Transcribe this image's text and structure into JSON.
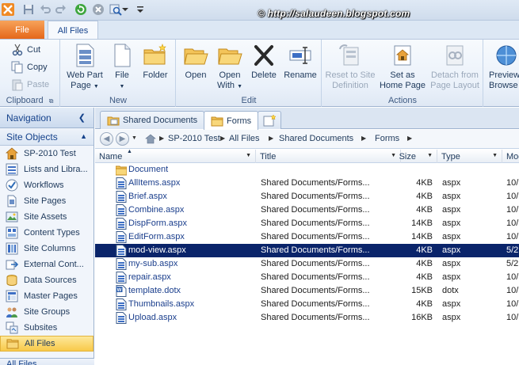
{
  "watermark": "© http://salaudeen.blogspot.com",
  "quick_access": {
    "icons": [
      "sharepoint-designer-logo-icon",
      "save-icon",
      "undo-icon",
      "redo-icon",
      "refresh-icon",
      "stop-icon",
      "preview-icon",
      "customize-toolbar-icon"
    ]
  },
  "tabs": {
    "file": "File",
    "all_files": "All Files"
  },
  "ribbon": {
    "clipboard": {
      "label": "Clipboard",
      "cut": "Cut",
      "copy": "Copy",
      "paste": "Paste"
    },
    "new": {
      "label": "New",
      "web_part_page_l1": "Web Part",
      "web_part_page_l2": "Page",
      "file_l1": "File",
      "folder": "Folder"
    },
    "edit": {
      "label": "Edit",
      "open": "Open",
      "open_with_l1": "Open",
      "open_with_l2": "With",
      "delete": "Delete",
      "rename": "Rename"
    },
    "actions": {
      "label": "Actions",
      "reset_l1": "Reset to Site",
      "reset_l2": "Definition",
      "set_home_l1": "Set as",
      "set_home_l2": "Home Page",
      "detach_l1": "Detach from",
      "detach_l2": "Page Layout"
    },
    "preview": {
      "l1": "Preview",
      "l2": "Browse"
    }
  },
  "navigation": {
    "title": "Navigation",
    "section": "Site Objects",
    "items": [
      {
        "label": "SP-2010 Test",
        "icon": "site-home-icon"
      },
      {
        "label": "Lists and Libra...",
        "icon": "lists-icon"
      },
      {
        "label": "Workflows",
        "icon": "workflow-icon"
      },
      {
        "label": "Site Pages",
        "icon": "site-pages-icon"
      },
      {
        "label": "Site Assets",
        "icon": "site-assets-icon"
      },
      {
        "label": "Content Types",
        "icon": "content-types-icon"
      },
      {
        "label": "Site Columns",
        "icon": "site-columns-icon"
      },
      {
        "label": "External Cont...",
        "icon": "external-content-icon"
      },
      {
        "label": "Data Sources",
        "icon": "data-sources-icon"
      },
      {
        "label": "Master Pages",
        "icon": "master-pages-icon"
      },
      {
        "label": "Site Groups",
        "icon": "site-groups-icon"
      },
      {
        "label": "Subsites",
        "icon": "subsites-icon"
      },
      {
        "label": "All Files",
        "icon": "all-files-icon"
      }
    ],
    "bottom_section": "All Files"
  },
  "doc_tabs": [
    {
      "label": "Shared Documents"
    },
    {
      "label": "Forms"
    }
  ],
  "breadcrumb": [
    "SP-2010 Test",
    "All Files",
    "Shared Documents",
    "Forms"
  ],
  "columns": {
    "name": "Name",
    "title": "Title",
    "size": "Size",
    "type": "Type",
    "modified": "Mod"
  },
  "files": [
    {
      "name": "Document",
      "title": "",
      "size": "",
      "type": "",
      "mod": "",
      "kind": "folder"
    },
    {
      "name": "AllItems.aspx",
      "title": "Shared Documents/Forms...",
      "size": "4KB",
      "type": "aspx",
      "mod": "10/",
      "kind": "page"
    },
    {
      "name": "Brief.aspx",
      "title": "Shared Documents/Forms...",
      "size": "4KB",
      "type": "aspx",
      "mod": "10/",
      "kind": "page"
    },
    {
      "name": "Combine.aspx",
      "title": "Shared Documents/Forms...",
      "size": "4KB",
      "type": "aspx",
      "mod": "10/",
      "kind": "page"
    },
    {
      "name": "DispForm.aspx",
      "title": "Shared Documents/Forms...",
      "size": "14KB",
      "type": "aspx",
      "mod": "10/",
      "kind": "page"
    },
    {
      "name": "EditForm.aspx",
      "title": "Shared Documents/Forms...",
      "size": "14KB",
      "type": "aspx",
      "mod": "10/",
      "kind": "page"
    },
    {
      "name": "mod-view.aspx",
      "title": "Shared Documents/Forms...",
      "size": "4KB",
      "type": "aspx",
      "mod": "5/2",
      "kind": "page",
      "selected": true
    },
    {
      "name": "my-sub.aspx",
      "title": "Shared Documents/Forms...",
      "size": "4KB",
      "type": "aspx",
      "mod": "5/2",
      "kind": "page"
    },
    {
      "name": "repair.aspx",
      "title": "Shared Documents/Forms...",
      "size": "4KB",
      "type": "aspx",
      "mod": "10/",
      "kind": "page"
    },
    {
      "name": "template.dotx",
      "title": "Shared Documents/Forms...",
      "size": "15KB",
      "type": "dotx",
      "mod": "10/",
      "kind": "word"
    },
    {
      "name": "Thumbnails.aspx",
      "title": "Shared Documents/Forms...",
      "size": "4KB",
      "type": "aspx",
      "mod": "10/",
      "kind": "page"
    },
    {
      "name": "Upload.aspx",
      "title": "Shared Documents/Forms...",
      "size": "16KB",
      "type": "aspx",
      "mod": "10/",
      "kind": "page"
    }
  ]
}
